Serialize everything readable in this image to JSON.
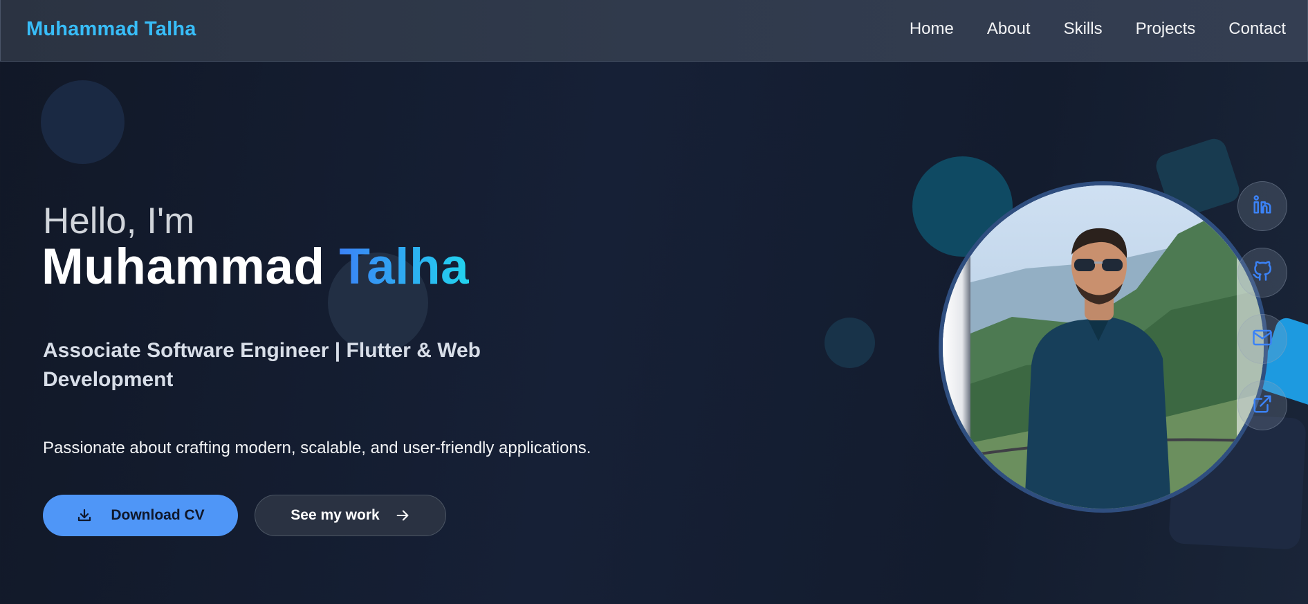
{
  "nav": {
    "brand": "Muhammad Talha",
    "links": [
      "Home",
      "About",
      "Skills",
      "Projects",
      "Contact"
    ]
  },
  "hero": {
    "greeting": "Hello, I'm",
    "name_first": "Muhammad",
    "name_last": "Talha",
    "role": "Associate Software Engineer | Flutter & Web Development",
    "tagline": "Passionate about crafting modern, scalable, and user-friendly applications."
  },
  "buttons": {
    "download": {
      "label": "Download CV",
      "icon": "download-icon"
    },
    "work": {
      "label": "See my work",
      "icon": "arrow-right-icon"
    }
  },
  "social": [
    {
      "icon": "linkedin-icon"
    },
    {
      "icon": "github-icon"
    },
    {
      "icon": "mail-icon"
    },
    {
      "icon": "external-link-icon"
    }
  ],
  "colors": {
    "accent": "#38bdf8",
    "accent_blue": "#3b82f6",
    "button_primary": "#4f96f7",
    "background": "#111827",
    "navbar": "#303a4c"
  }
}
